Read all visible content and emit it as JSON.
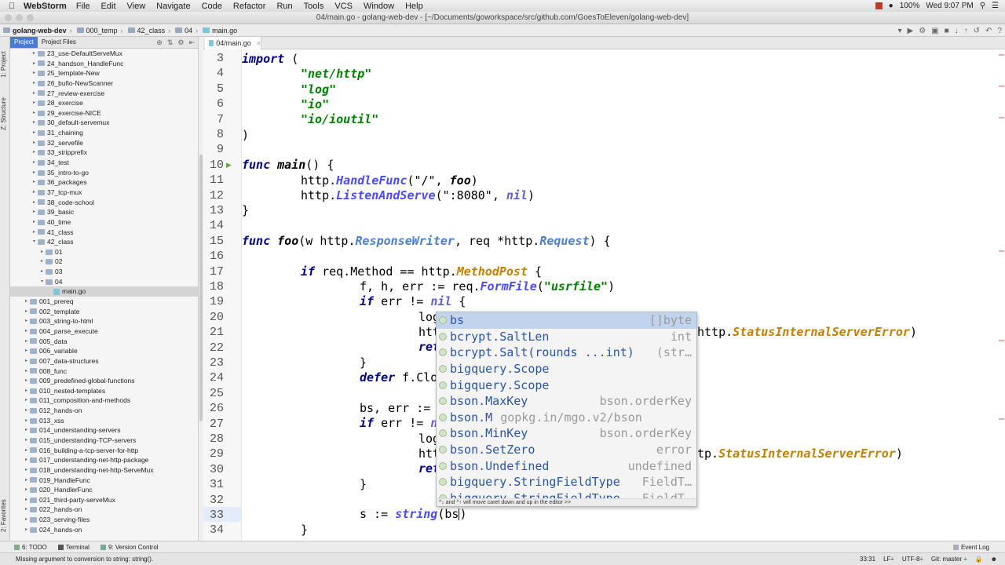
{
  "menubar": {
    "app_name": "WebStorm",
    "items": [
      "File",
      "Edit",
      "View",
      "Navigate",
      "Code",
      "Refactor",
      "Run",
      "Tools",
      "VCS",
      "Window",
      "Help"
    ],
    "battery": "100%",
    "clock": "Wed 9:07 PM"
  },
  "window": {
    "title": "04/main.go - golang-web-dev - [~/Documents/goworkspace/src/github.com/GoesToEleven/golang-web-dev]"
  },
  "breadcrumbs": [
    "golang-web-dev",
    "000_temp",
    "42_class",
    "04",
    "main.go"
  ],
  "left_strip": {
    "project": "1: Project",
    "structure": "Z: Structure",
    "favorites": "2: Favorites"
  },
  "project_panel": {
    "tabs": [
      "Project",
      "Project Files"
    ],
    "tree": [
      {
        "label": "23_use-DefaultServeMux",
        "indent": 3,
        "arrow": "▸"
      },
      {
        "label": "24_handson_HandleFunc",
        "indent": 3,
        "arrow": "▸"
      },
      {
        "label": "25_template-New",
        "indent": 3,
        "arrow": "▸"
      },
      {
        "label": "26_bufio-NewScanner",
        "indent": 3,
        "arrow": "▸"
      },
      {
        "label": "27_review-exercise",
        "indent": 3,
        "arrow": "▸"
      },
      {
        "label": "28_exercise",
        "indent": 3,
        "arrow": "▸"
      },
      {
        "label": "29_exercise-NICE",
        "indent": 3,
        "arrow": "▸"
      },
      {
        "label": "30_default-servemux",
        "indent": 3,
        "arrow": "▸"
      },
      {
        "label": "31_chaining",
        "indent": 3,
        "arrow": "▸"
      },
      {
        "label": "32_servefile",
        "indent": 3,
        "arrow": "▸"
      },
      {
        "label": "33_stripprefix",
        "indent": 3,
        "arrow": "▸"
      },
      {
        "label": "34_test",
        "indent": 3,
        "arrow": "▸"
      },
      {
        "label": "35_intro-to-go",
        "indent": 3,
        "arrow": "▸"
      },
      {
        "label": "36_packages",
        "indent": 3,
        "arrow": "▸"
      },
      {
        "label": "37_tcp-mux",
        "indent": 3,
        "arrow": "▸"
      },
      {
        "label": "38_code-school",
        "indent": 3,
        "arrow": "▸"
      },
      {
        "label": "39_basic",
        "indent": 3,
        "arrow": "▸"
      },
      {
        "label": "40_time",
        "indent": 3,
        "arrow": "▸"
      },
      {
        "label": "41_class",
        "indent": 3,
        "arrow": "▸"
      },
      {
        "label": "42_class",
        "indent": 3,
        "arrow": "▾"
      },
      {
        "label": "01",
        "indent": 4,
        "arrow": "▸"
      },
      {
        "label": "02",
        "indent": 4,
        "arrow": "▸"
      },
      {
        "label": "03",
        "indent": 4,
        "arrow": "▸"
      },
      {
        "label": "04",
        "indent": 4,
        "arrow": "▾"
      },
      {
        "label": "main.go",
        "indent": 5,
        "arrow": "",
        "file": true,
        "selected": true
      },
      {
        "label": "001_prereq",
        "indent": 2,
        "arrow": "▸"
      },
      {
        "label": "002_template",
        "indent": 2,
        "arrow": "▸"
      },
      {
        "label": "003_string-to-html",
        "indent": 2,
        "arrow": "▸"
      },
      {
        "label": "004_parse_execute",
        "indent": 2,
        "arrow": "▸"
      },
      {
        "label": "005_data",
        "indent": 2,
        "arrow": "▸"
      },
      {
        "label": "006_variable",
        "indent": 2,
        "arrow": "▸"
      },
      {
        "label": "007_data-structures",
        "indent": 2,
        "arrow": "▸"
      },
      {
        "label": "008_func",
        "indent": 2,
        "arrow": "▸"
      },
      {
        "label": "009_predefined-global-functions",
        "indent": 2,
        "arrow": "▸"
      },
      {
        "label": "010_nested-templates",
        "indent": 2,
        "arrow": "▸"
      },
      {
        "label": "011_composition-and-methods",
        "indent": 2,
        "arrow": "▸"
      },
      {
        "label": "012_hands-on",
        "indent": 2,
        "arrow": "▸"
      },
      {
        "label": "013_xss",
        "indent": 2,
        "arrow": "▸"
      },
      {
        "label": "014_understanding-servers",
        "indent": 2,
        "arrow": "▸"
      },
      {
        "label": "015_understanding-TCP-servers",
        "indent": 2,
        "arrow": "▸"
      },
      {
        "label": "016_building-a-tcp-server-for-http",
        "indent": 2,
        "arrow": "▸"
      },
      {
        "label": "017_understanding-net-http-package",
        "indent": 2,
        "arrow": "▸"
      },
      {
        "label": "018_understanding-net-http-ServeMux",
        "indent": 2,
        "arrow": "▸"
      },
      {
        "label": "019_HandleFunc",
        "indent": 2,
        "arrow": "▸"
      },
      {
        "label": "020_HandlerFunc",
        "indent": 2,
        "arrow": "▸"
      },
      {
        "label": "021_third-party-serveMux",
        "indent": 2,
        "arrow": "▸"
      },
      {
        "label": "022_hands-on",
        "indent": 2,
        "arrow": "▸"
      },
      {
        "label": "023_serving-files",
        "indent": 2,
        "arrow": "▸"
      },
      {
        "label": "024_hands-on",
        "indent": 2,
        "arrow": "▸"
      }
    ]
  },
  "editor": {
    "tab_label": "04/main.go",
    "line_numbers": [
      "3",
      "4",
      "5",
      "6",
      "7",
      "8",
      "9",
      "10",
      "11",
      "12",
      "13",
      "14",
      "15",
      "16",
      "17",
      "18",
      "19",
      "20",
      "21",
      "22",
      "23",
      "24",
      "25",
      "26",
      "27",
      "28",
      "29",
      "30",
      "31",
      "32",
      "33",
      "34"
    ],
    "code": {
      "l3_kw": "import",
      "l3_rest": " (",
      "l4": "\"net/http\"",
      "l5": "\"log\"",
      "l6": "\"io\"",
      "l7": "\"io/ioutil\"",
      "l8": ")",
      "l10_kw": "func",
      "l10_fn": "main",
      "l10_rest": "() {",
      "l11_a": "http.",
      "l11_m": "HandleFunc",
      "l11_b": "(\"/\", ",
      "l11_c": "foo",
      "l11_d": ")",
      "l12_a": "http.",
      "l12_m": "ListenAndServe",
      "l12_b": "(\":8080\", ",
      "l12_nil": "nil",
      "l12_d": ")",
      "l13": "}",
      "l15_kw": "func",
      "l15_fn": "foo",
      "l15_a": "(w http.",
      "l15_t1": "ResponseWriter",
      "l15_b": ", req *http.",
      "l15_t2": "Request",
      "l15_c": ") {",
      "l17_kw": "if",
      "l17_a": " req.Method == http.",
      "l17_c": "MethodPost",
      "l17_b": " {",
      "l18_a": "f, h, err := req.",
      "l18_m": "FormFile",
      "l18_b": "(",
      "l18_s": "\"usrfile\"",
      "l18_c": ")",
      "l19_kw": "if",
      "l19_a": " err != ",
      "l19_nil": "nil",
      "l19_b": " {",
      "l20": "log",
      "l21_a": "htt",
      "l21_tail_a": "http.",
      "l21_tail_c": "StatusInternalServerError",
      "l21_tail_b": ")",
      "l22": "ret",
      "l23": "}",
      "l24_kw": "defer",
      "l24_a": " f.Clo",
      "l26_a": "bs, err :=",
      "l27_kw": "if",
      "l27_a": " err != ",
      "l27_b": "n",
      "l28": "log",
      "l29_a": "htt",
      "l29_tail_a": "tp.",
      "l29_tail_c": "StatusInternalServerError",
      "l29_tail_b": ")",
      "l30": "ret",
      "l31": "}",
      "l33_a": "s := ",
      "l33_fn": "string",
      "l33_b": "(bs",
      "l34": "}"
    }
  },
  "autocomplete": {
    "items": [
      {
        "name": "bs",
        "type": "[]byte",
        "selected": true
      },
      {
        "name": "bcrypt.SaltLen",
        "type": "int"
      },
      {
        "name": "bcrypt.Salt(rounds ...int)",
        "type": "(str…"
      },
      {
        "name": "bigquery.Scope",
        "type": ""
      },
      {
        "name": "bigquery.Scope",
        "type": ""
      },
      {
        "name": "bson.MaxKey",
        "type": "bson.orderKey"
      },
      {
        "name": "bson.M",
        "type": "gopkg.in/mgo.v2/bson",
        "inline": true
      },
      {
        "name": "bson.MinKey",
        "type": "bson.orderKey"
      },
      {
        "name": "bson.SetZero",
        "type": "error"
      },
      {
        "name": "bson.Undefined",
        "type": "undefined"
      },
      {
        "name": "bigquery.StringFieldType",
        "type": "FieldT…"
      },
      {
        "name": "bigquery.StringFieldType",
        "type": "FieldT…"
      }
    ],
    "footer": "^↓ and ^↑ will move caret down and up in the editor  >>"
  },
  "bottom_tools": {
    "todo": "6: TODO",
    "terminal": "Terminal",
    "vcs": "9: Version Control",
    "event_log": "Event Log"
  },
  "status": {
    "message": "Missing argument to conversion to string: string().",
    "position": "33:31",
    "line_sep": "LF÷",
    "encoding": "UTF-8÷",
    "git": "Git: master ÷"
  },
  "colors": {
    "accent": "#4a7bd0",
    "current_line": "#e4ebfa",
    "popup_selected": "#c2d3ee"
  }
}
